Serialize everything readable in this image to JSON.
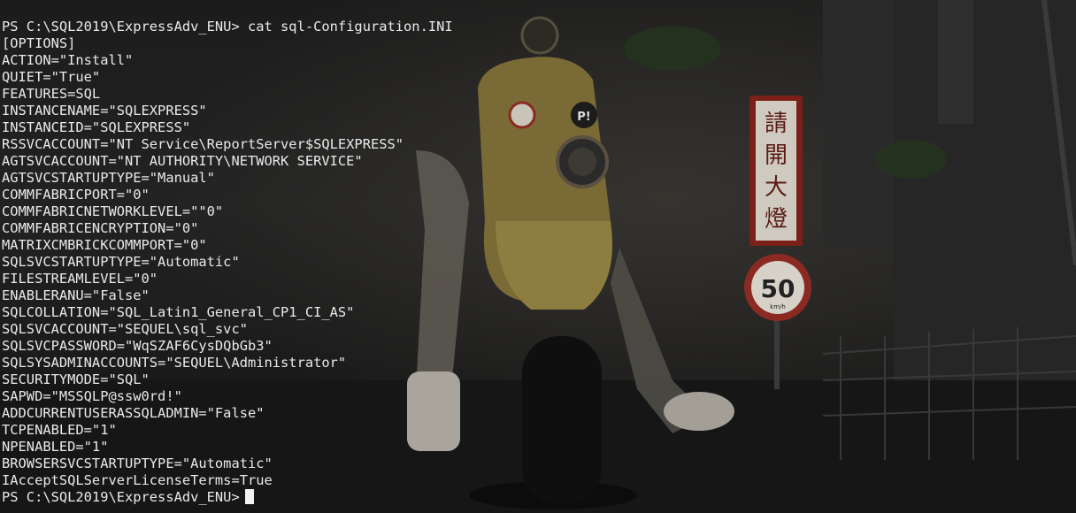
{
  "terminal": {
    "lines": [
      "PS C:\\SQL2019\\ExpressAdv_ENU> cat sql-Configuration.INI",
      "[OPTIONS]",
      "ACTION=\"Install\"",
      "QUIET=\"True\"",
      "FEATURES=SQL",
      "INSTANCENAME=\"SQLEXPRESS\"",
      "INSTANCEID=\"SQLEXPRESS\"",
      "RSSVCACCOUNT=\"NT Service\\ReportServer$SQLEXPRESS\"",
      "AGTSVCACCOUNT=\"NT AUTHORITY\\NETWORK SERVICE\"",
      "AGTSVCSTARTUPTYPE=\"Manual\"",
      "COMMFABRICPORT=\"0\"",
      "COMMFABRICNETWORKLEVEL=\"\"0\"",
      "COMMFABRICENCRYPTION=\"0\"",
      "MATRIXCMBRICKCOMMPORT=\"0\"",
      "SQLSVCSTARTUPTYPE=\"Automatic\"",
      "FILESTREAMLEVEL=\"0\"",
      "ENABLERANU=\"False\"",
      "SQLCOLLATION=\"SQL_Latin1_General_CP1_CI_AS\"",
      "SQLSVCACCOUNT=\"SEQUEL\\sql_svc\"",
      "SQLSVCPASSWORD=\"WqSZAF6CysDQbGb3\"",
      "SQLSYSADMINACCOUNTS=\"SEQUEL\\Administrator\"",
      "SECURITYMODE=\"SQL\"",
      "SAPWD=\"MSSQLP@ssw0rd!\"",
      "ADDCURRENTUSERASSQLADMIN=\"False\"",
      "TCPENABLED=\"1\"",
      "NPENABLED=\"1\"",
      "BROWSERSVCSTARTUPTYPE=\"Automatic\"",
      "IAcceptSQLServerLicenseTerms=True"
    ],
    "prompt": "PS C:\\SQL2019\\ExpressAdv_ENU>"
  },
  "wallpaper": {
    "sign_characters": [
      "請",
      "開",
      "大",
      "燈"
    ],
    "speed_sign": "50",
    "speed_unit": "km/h",
    "sticker_text": "P!"
  },
  "colors": {
    "text": "#eaeaea",
    "background": "#1c1c1c",
    "scooter": "#8a7a3e",
    "sign_red": "#9b2a22"
  }
}
